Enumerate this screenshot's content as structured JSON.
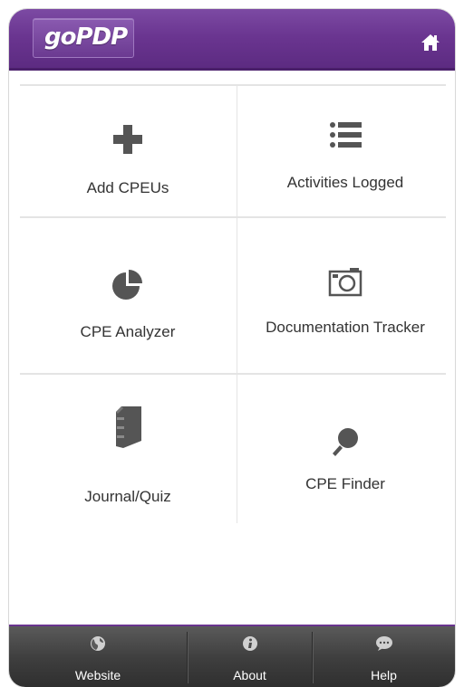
{
  "app": {
    "logo_text": "goPDP"
  },
  "header": {
    "home_icon": "home-icon"
  },
  "menu": {
    "tiles": [
      {
        "label": "Add CPEUs",
        "icon": "plus-icon"
      },
      {
        "label": "Activities Logged",
        "icon": "list-icon"
      },
      {
        "label": "CPE Analyzer",
        "icon": "pie-chart-icon"
      },
      {
        "label": "Documentation Tracker",
        "icon": "camera-icon"
      },
      {
        "label": "Journal/Quiz",
        "icon": "book-icon"
      },
      {
        "label": "CPE Finder",
        "icon": "magnifier-icon"
      }
    ]
  },
  "footer": {
    "tabs": [
      {
        "label": "Website",
        "icon": "globe-icon"
      },
      {
        "label": "About",
        "icon": "info-icon"
      },
      {
        "label": "Help",
        "icon": "speech-bubble-icon"
      }
    ]
  },
  "colors": {
    "brand": "#6a3590",
    "icon_gray": "#555555",
    "footer": "#3f3f3f"
  }
}
